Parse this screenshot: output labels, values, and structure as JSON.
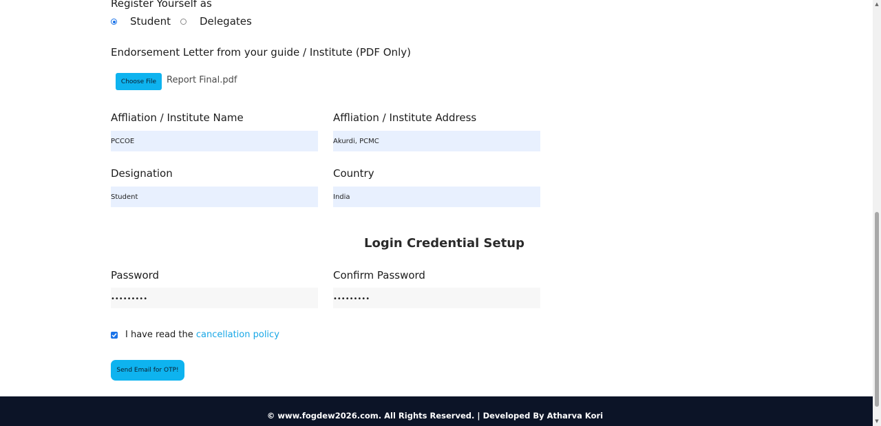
{
  "registration": {
    "title": "Register Yourself as",
    "options": [
      {
        "label": "Student",
        "selected": true
      },
      {
        "label": "Delegates",
        "selected": false
      }
    ]
  },
  "endorsement": {
    "label": "Endorsement Letter from your guide / Institute (PDF Only)",
    "button_label": "Choose File",
    "file_name": "Report Final.pdf"
  },
  "fields": {
    "institute_name": {
      "label": "Affliation / Institute Name",
      "value": "PCCOE"
    },
    "institute_address": {
      "label": "Affliation / Institute Address",
      "value": "Akurdi, PCMC"
    },
    "designation": {
      "label": "Designation",
      "value": "Student"
    },
    "country": {
      "label": "Country",
      "value": "India"
    }
  },
  "credentials": {
    "title": "Login Credential Setup",
    "password": {
      "label": "Password",
      "value": "•••••••••"
    },
    "confirm_password": {
      "label": "Confirm Password",
      "value": "•••••••••"
    }
  },
  "agreement": {
    "checked": true,
    "text": "I have read the",
    "link_text": "cancellation policy"
  },
  "actions": {
    "otp_button": "Send Email for OTP!"
  },
  "footer": {
    "text": "© www.fogdew2026.com. All Rights Reserved. | Developed By Atharva Kori"
  },
  "colors": {
    "accent": "#0eb3ef",
    "footer_bg": "#0c1427",
    "input_bg": "#e8f0fe",
    "link": "#18a7e6"
  }
}
